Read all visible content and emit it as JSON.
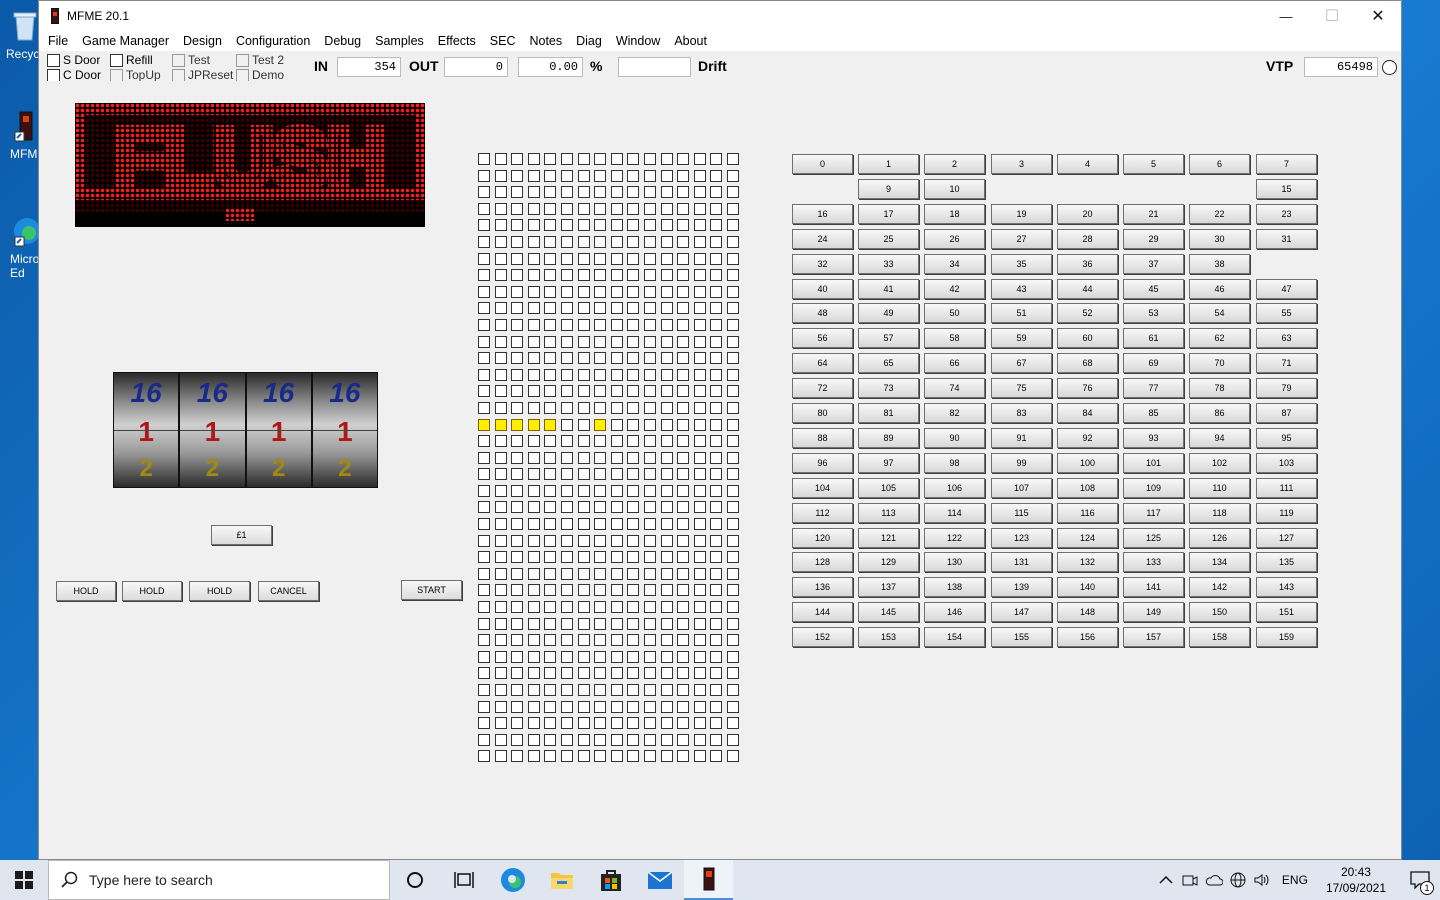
{
  "desktop": {
    "icons": [
      {
        "label": "Recycle Bin",
        "shown": "Recyc"
      },
      {
        "label": "MFME",
        "shown": "MFM"
      },
      {
        "label": "Microsoft Edge",
        "shown": "Micro\nEd"
      }
    ]
  },
  "window": {
    "title": "MFME 20.1",
    "controls": {
      "minimize": "—",
      "maximize": "☐",
      "close": "✕"
    }
  },
  "menu": [
    "File",
    "Game Manager",
    "Design",
    "Configuration",
    "Debug",
    "Samples",
    "Effects",
    "SEC",
    "Notes",
    "Diag",
    "Window",
    "About"
  ],
  "toolbar": {
    "checkboxes": [
      {
        "label": "S Door",
        "enabled": true
      },
      {
        "label": "C Door",
        "enabled": true
      },
      {
        "label": "Refill",
        "enabled": true
      },
      {
        "label": "TopUp",
        "enabled": false
      },
      {
        "label": "Test",
        "enabled": false
      },
      {
        "label": "JPReset",
        "enabled": false
      },
      {
        "label": "Test 2",
        "enabled": false
      },
      {
        "label": "Demo",
        "enabled": false
      }
    ],
    "in_label": "IN",
    "in_value": "354",
    "out_label": "OUT",
    "out_value": "0",
    "percent_value": "0.00",
    "percent_symbol": "%",
    "drift_value": "",
    "drift_label": "Drift",
    "vtp_label": "VTP",
    "vtp_value": "65498"
  },
  "dmd": {
    "text": "FLUSH",
    "color": "#e01010"
  },
  "reels": {
    "count": 4,
    "symbols": [
      "16",
      "1",
      "2"
    ]
  },
  "buttons": {
    "coin": "£1",
    "hold1": "HOLD",
    "hold2": "HOLD",
    "hold3": "HOLD",
    "cancel": "CANCEL",
    "start": "START"
  },
  "lamp_grid": {
    "columns": 16,
    "rows": 37,
    "lit": [
      [
        16,
        0
      ],
      [
        16,
        1
      ],
      [
        16,
        2
      ],
      [
        16,
        3
      ],
      [
        16,
        4
      ],
      [
        16,
        7
      ]
    ],
    "lit_color": "#ffee00"
  },
  "input_buttons": {
    "rows": [
      [
        "0",
        "1",
        "2",
        "3",
        "4",
        "5",
        "6",
        "7"
      ],
      [
        "",
        "9",
        "10",
        "",
        "",
        "",
        "",
        "15"
      ],
      [
        "16",
        "17",
        "18",
        "19",
        "20",
        "21",
        "22",
        "23"
      ],
      [
        "24",
        "25",
        "26",
        "27",
        "28",
        "29",
        "30",
        "31"
      ],
      [
        "32",
        "33",
        "34",
        "35",
        "36",
        "37",
        "38",
        ""
      ],
      [
        "40",
        "41",
        "42",
        "43",
        "44",
        "45",
        "46",
        "47"
      ],
      [
        "48",
        "49",
        "50",
        "51",
        "52",
        "53",
        "54",
        "55"
      ],
      [
        "56",
        "57",
        "58",
        "59",
        "60",
        "61",
        "62",
        "63"
      ],
      [
        "64",
        "65",
        "66",
        "67",
        "68",
        "69",
        "70",
        "71"
      ],
      [
        "72",
        "73",
        "74",
        "75",
        "76",
        "77",
        "78",
        "79"
      ],
      [
        "80",
        "81",
        "82",
        "83",
        "84",
        "85",
        "86",
        "87"
      ],
      [
        "88",
        "89",
        "90",
        "91",
        "92",
        "93",
        "94",
        "95"
      ],
      [
        "96",
        "97",
        "98",
        "99",
        "100",
        "101",
        "102",
        "103"
      ],
      [
        "104",
        "105",
        "106",
        "107",
        "108",
        "109",
        "110",
        "111"
      ],
      [
        "112",
        "113",
        "114",
        "115",
        "116",
        "117",
        "118",
        "119"
      ],
      [
        "120",
        "121",
        "122",
        "123",
        "124",
        "125",
        "126",
        "127"
      ],
      [
        "128",
        "129",
        "130",
        "131",
        "132",
        "133",
        "134",
        "135"
      ],
      [
        "136",
        "137",
        "138",
        "139",
        "140",
        "141",
        "142",
        "143"
      ],
      [
        "144",
        "145",
        "146",
        "147",
        "148",
        "149",
        "150",
        "151"
      ],
      [
        "152",
        "153",
        "154",
        "155",
        "156",
        "157",
        "158",
        "159"
      ]
    ]
  },
  "taskbar": {
    "search_placeholder": "Type here to search",
    "language": "ENG",
    "time": "20:43",
    "date": "17/09/2021",
    "notification_count": "1"
  }
}
